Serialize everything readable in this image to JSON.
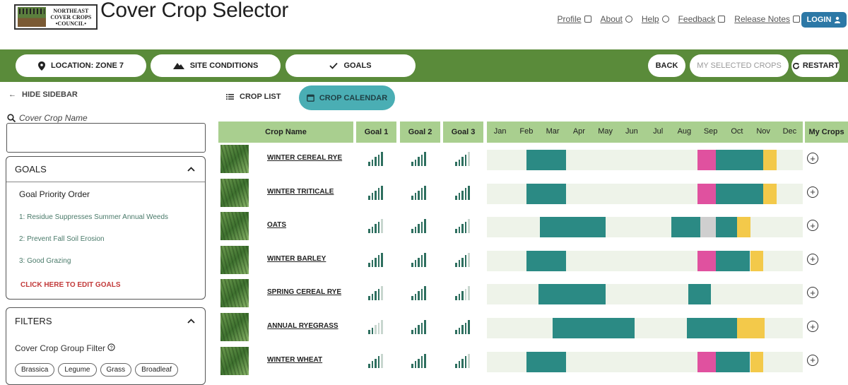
{
  "header": {
    "logo_text": [
      "NORTHEAST",
      "COVER CROPS",
      "•COUNCIL•"
    ],
    "title": "Cover Crop Selector",
    "links": [
      "Profile",
      "About",
      "Help",
      "Feedback",
      "Release Notes"
    ],
    "login": "LOGIN"
  },
  "nav": {
    "location": "LOCATION: ZONE 7",
    "site": "SITE CONDITIONS",
    "goals": "GOALS",
    "back": "BACK",
    "my_selected": "MY SELECTED CROPS",
    "restart": "RESTART"
  },
  "sidebar": {
    "hide": "HIDE SIDEBAR",
    "search_label": "Cover Crop Name",
    "goals_title": "GOALS",
    "priority_title": "Goal Priority Order",
    "goal_items": [
      "1: Residue Suppresses Summer Annual Weeds",
      "2: Prevent Fall Soil Erosion",
      "3: Good Grazing"
    ],
    "edit_goals": "CLICK HERE TO EDIT GOALS",
    "filters_title": "FILTERS",
    "filter_label": "Cover Crop Group Filter",
    "chips": [
      "Brassica",
      "Legume",
      "Grass",
      "Broadleaf"
    ]
  },
  "view": {
    "crop_list": "CROP LIST",
    "crop_calendar": "CROP CALENDAR"
  },
  "table": {
    "headers": {
      "crop_name": "Crop Name",
      "goal1": "Goal 1",
      "goal2": "Goal 2",
      "goal3": "Goal 3",
      "my_crops": "My Crops"
    },
    "months": [
      "Jan",
      "Feb",
      "Mar",
      "Apr",
      "May",
      "Jun",
      "Jul",
      "Aug",
      "Sep",
      "Oct",
      "Nov",
      "Dec"
    ],
    "colors": {
      "teal": "#2b8a84",
      "magenta": "#e0519f",
      "yellow": "#f3c94a",
      "gray": "#cfcfcf",
      "track": "#eef3e9"
    },
    "rows": [
      {
        "name": "WINTER CEREAL RYE",
        "ratings": [
          4,
          4,
          3
        ],
        "segments": [
          {
            "start": 1.5,
            "end": 3.0,
            "color": "teal"
          },
          {
            "start": 8.0,
            "end": 8.7,
            "color": "magenta"
          },
          {
            "start": 8.7,
            "end": 10.5,
            "color": "teal"
          },
          {
            "start": 10.5,
            "end": 11.0,
            "color": "yellow"
          }
        ]
      },
      {
        "name": "WINTER TRITICALE",
        "ratings": [
          4,
          4,
          4
        ],
        "segments": [
          {
            "start": 1.5,
            "end": 3.0,
            "color": "teal"
          },
          {
            "start": 8.0,
            "end": 8.7,
            "color": "magenta"
          },
          {
            "start": 8.7,
            "end": 10.5,
            "color": "teal"
          },
          {
            "start": 10.5,
            "end": 11.0,
            "color": "yellow"
          }
        ]
      },
      {
        "name": "OATS",
        "ratings": [
          3,
          4,
          3
        ],
        "segments": [
          {
            "start": 2.0,
            "end": 4.5,
            "color": "teal"
          },
          {
            "start": 7.0,
            "end": 8.1,
            "color": "teal"
          },
          {
            "start": 8.1,
            "end": 8.7,
            "color": "gray"
          },
          {
            "start": 8.7,
            "end": 9.5,
            "color": "teal"
          },
          {
            "start": 9.5,
            "end": 10.0,
            "color": "yellow"
          }
        ]
      },
      {
        "name": "WINTER BARLEY",
        "ratings": [
          4,
          4,
          3
        ],
        "segments": [
          {
            "start": 1.5,
            "end": 3.0,
            "color": "teal"
          },
          {
            "start": 8.0,
            "end": 8.7,
            "color": "magenta"
          },
          {
            "start": 8.7,
            "end": 10.0,
            "color": "teal"
          },
          {
            "start": 10.0,
            "end": 10.5,
            "color": "yellow"
          }
        ]
      },
      {
        "name": "SPRING CEREAL RYE",
        "ratings": [
          3,
          4,
          2
        ],
        "segments": [
          {
            "start": 1.95,
            "end": 4.5,
            "color": "teal"
          },
          {
            "start": 7.65,
            "end": 8.5,
            "color": "teal"
          }
        ]
      },
      {
        "name": "ANNUAL RYEGRASS",
        "ratings": [
          1,
          4,
          4
        ],
        "segments": [
          {
            "start": 2.5,
            "end": 5.6,
            "color": "teal"
          },
          {
            "start": 7.6,
            "end": 9.5,
            "color": "teal"
          },
          {
            "start": 9.5,
            "end": 10.55,
            "color": "yellow"
          }
        ]
      },
      {
        "name": "WINTER WHEAT",
        "ratings": [
          3,
          4,
          3
        ],
        "segments": [
          {
            "start": 1.5,
            "end": 3.0,
            "color": "teal"
          },
          {
            "start": 8.0,
            "end": 8.7,
            "color": "magenta"
          },
          {
            "start": 8.7,
            "end": 10.0,
            "color": "teal"
          },
          {
            "start": 10.0,
            "end": 10.5,
            "color": "yellow"
          }
        ]
      }
    ]
  }
}
